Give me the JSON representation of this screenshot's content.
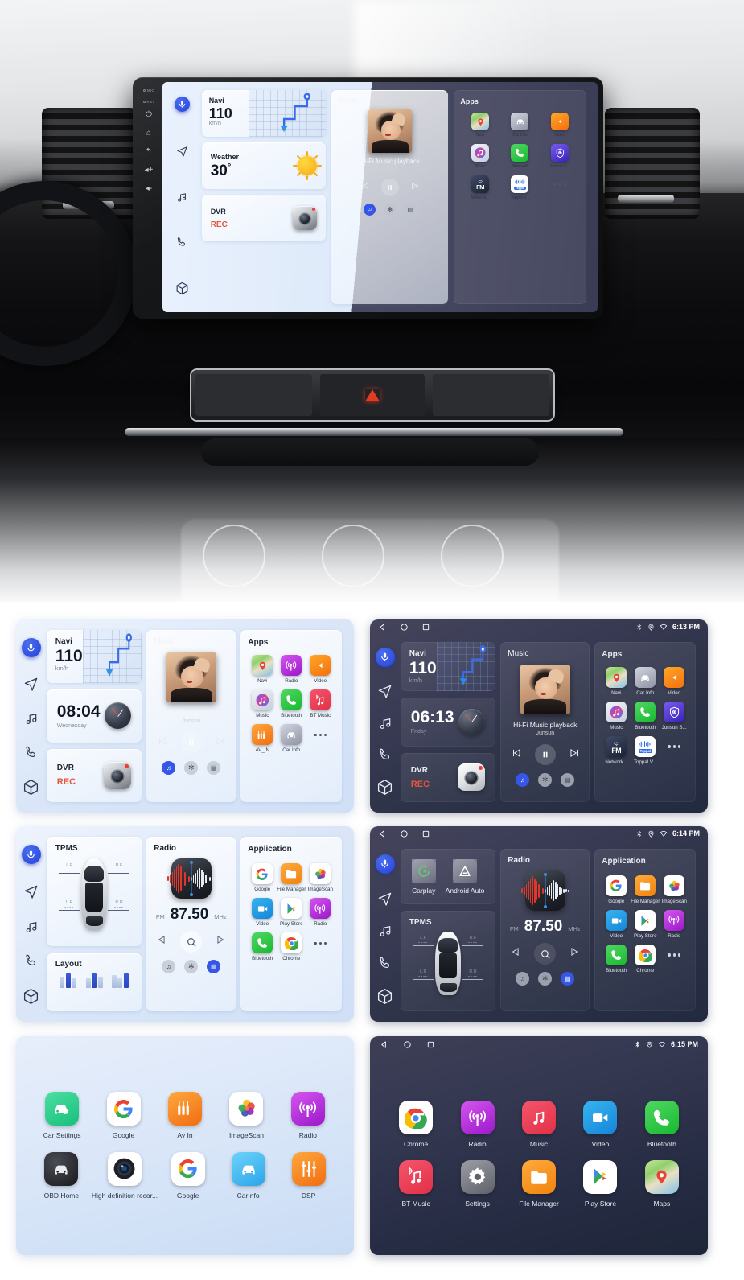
{
  "product": {
    "brand": "Junsun",
    "headunit_side_buttons": [
      "MIC",
      "RST",
      "power-icon",
      "home-icon",
      "back-icon",
      "volume-up-icon",
      "volume-down-icon"
    ]
  },
  "rail": {
    "items": [
      {
        "name": "voice-assistant",
        "icon": "microphone-icon"
      },
      {
        "name": "navigation",
        "icon": "paper-plane-icon"
      },
      {
        "name": "music",
        "icon": "music-note-icon"
      },
      {
        "name": "phone",
        "icon": "phone-handset-icon"
      },
      {
        "name": "apps",
        "icon": "cube-icon"
      }
    ]
  },
  "statusbar": {
    "nav_icons": [
      "back-triangle-icon",
      "home-circle-icon",
      "recents-square-icon"
    ],
    "tray_icons": [
      "bluetooth-icon",
      "location-pin-icon",
      "wifi-icon"
    ],
    "time_1": "6:13 PM",
    "time_2": "6:14 PM",
    "time_3": "6:15 PM"
  },
  "hero": {
    "navi": {
      "title": "Navi",
      "speed": "110",
      "unit": "km/h"
    },
    "weather": {
      "title": "Weather",
      "temp": "30",
      "degree": "°"
    },
    "dvr": {
      "title": "DVR",
      "status": "REC"
    },
    "music": {
      "title": "Music",
      "song": "Hi-Fi Music playback",
      "artist": "Junsun"
    },
    "apps": {
      "title": "Apps",
      "items": [
        {
          "label": "Navi",
          "icon": "maps-pin-icon"
        },
        {
          "label": "Car Info",
          "icon": "car-icon"
        },
        {
          "label": "Video",
          "icon": "play-triangle-icon"
        },
        {
          "label": "Music",
          "icon": "music-note-icon"
        },
        {
          "label": "Bluetooth",
          "icon": "phone-handset-icon"
        },
        {
          "label": "Junsun S...",
          "icon": "shield-icon"
        },
        {
          "label": "Network...",
          "icon": "fm-icon"
        },
        {
          "label": "Toppal V...",
          "icon": "toppal-icon"
        },
        {
          "label": "",
          "icon": "more-dots-icon"
        }
      ]
    }
  },
  "screen_light_home": {
    "navi": {
      "title": "Navi",
      "speed": "110",
      "unit": "km/h"
    },
    "clock": {
      "time": "08:04",
      "day": "Wednesday"
    },
    "dvr": {
      "title": "DVR",
      "status": "REC"
    },
    "music": {
      "title": "Music",
      "song": "Hi-Fi Music playback",
      "artist": "Junsun"
    },
    "apps": {
      "title": "Apps",
      "items": [
        {
          "label": "Navi",
          "icon": "maps-pin-icon"
        },
        {
          "label": "Radio",
          "icon": "radio-antenna-icon"
        },
        {
          "label": "Video",
          "icon": "play-triangle-icon"
        },
        {
          "label": "Music",
          "icon": "music-note-icon"
        },
        {
          "label": "Bluetooth",
          "icon": "phone-handset-icon"
        },
        {
          "label": "BT Music",
          "icon": "bt-music-icon"
        },
        {
          "label": "AV_IN",
          "icon": "av-in-icon"
        },
        {
          "label": "Car Info",
          "icon": "car-icon"
        },
        {
          "label": "",
          "icon": "more-dots-icon"
        }
      ]
    }
  },
  "screen_dark_home": {
    "navi": {
      "title": "Navi",
      "speed": "110",
      "unit": "km/h"
    },
    "clock": {
      "time": "06:13",
      "day": "Friday"
    },
    "dvr": {
      "title": "DVR",
      "status": "REC"
    },
    "music": {
      "title": "Music",
      "song": "Hi-Fi Music playback",
      "artist": "Junsun"
    },
    "apps": {
      "title": "Apps",
      "items": [
        {
          "label": "Navi",
          "icon": "maps-pin-icon"
        },
        {
          "label": "Car Info",
          "icon": "car-icon"
        },
        {
          "label": "Video",
          "icon": "play-triangle-icon"
        },
        {
          "label": "Music",
          "icon": "music-note-icon"
        },
        {
          "label": "Bluetooth",
          "icon": "phone-handset-icon"
        },
        {
          "label": "Junsun S...",
          "icon": "shield-icon"
        },
        {
          "label": "Network...",
          "icon": "fm-icon"
        },
        {
          "label": "Toppal V...",
          "icon": "toppal-icon"
        },
        {
          "label": "",
          "icon": "more-dots-icon"
        }
      ]
    }
  },
  "screen_light_radio": {
    "tpms": {
      "title": "TPMS",
      "wheels": [
        {
          "pos": "L.F",
          "value": "----"
        },
        {
          "pos": "R.F",
          "value": "----"
        },
        {
          "pos": "L.R",
          "value": "----"
        },
        {
          "pos": "R.R",
          "value": "----"
        }
      ]
    },
    "layout": {
      "title": "Layout"
    },
    "radio": {
      "title": "Radio",
      "band": "FM",
      "freq": "87.50",
      "unit": "MHz"
    },
    "application": {
      "title": "Application",
      "items": [
        {
          "label": "Google",
          "icon": "google-g-icon"
        },
        {
          "label": "File Manager",
          "icon": "folder-icon"
        },
        {
          "label": "ImageScan",
          "icon": "photos-flower-icon"
        },
        {
          "label": "Video",
          "icon": "video-camera-icon"
        },
        {
          "label": "Play Store",
          "icon": "play-store-icon"
        },
        {
          "label": "Radio",
          "icon": "radio-antenna-icon"
        },
        {
          "label": "Bluetooth",
          "icon": "phone-handset-icon"
        },
        {
          "label": "Chrome",
          "icon": "chrome-icon"
        },
        {
          "label": "",
          "icon": "more-dots-icon"
        }
      ]
    }
  },
  "screen_dark_radio": {
    "projection": {
      "items": [
        {
          "label": "Carplay",
          "icon": "carplay-icon"
        },
        {
          "label": "Android Auto",
          "icon": "android-auto-icon"
        }
      ]
    },
    "tpms": {
      "title": "TPMS",
      "wheels": [
        {
          "pos": "L.F",
          "value": "----"
        },
        {
          "pos": "R.F",
          "value": "----"
        },
        {
          "pos": "L.R",
          "value": "----"
        },
        {
          "pos": "R.R",
          "value": "----"
        }
      ]
    },
    "radio": {
      "title": "Radio",
      "band": "FM",
      "freq": "87.50",
      "unit": "MHz"
    },
    "application": {
      "title": "Application",
      "items": [
        {
          "label": "Google",
          "icon": "google-g-icon"
        },
        {
          "label": "File Manager",
          "icon": "folder-icon"
        },
        {
          "label": "ImageScan",
          "icon": "photos-flower-icon"
        },
        {
          "label": "Video",
          "icon": "video-camera-icon"
        },
        {
          "label": "Play Store",
          "icon": "play-store-icon"
        },
        {
          "label": "Radio",
          "icon": "radio-antenna-icon"
        },
        {
          "label": "Bluetooth",
          "icon": "phone-handset-icon"
        },
        {
          "label": "Chrome",
          "icon": "chrome-icon"
        },
        {
          "label": "",
          "icon": "more-dots-icon"
        }
      ]
    }
  },
  "drawer_light": {
    "row1": [
      {
        "label": "Car Settings",
        "icon": "car-settings-icon"
      },
      {
        "label": "Google",
        "icon": "google-g-icon"
      },
      {
        "label": "Av In",
        "icon": "av-in-icon"
      },
      {
        "label": "ImageScan",
        "icon": "photos-flower-icon"
      },
      {
        "label": "Radio",
        "icon": "radio-antenna-icon"
      }
    ],
    "row2": [
      {
        "label": "OBD Home",
        "icon": "obd-car-icon"
      },
      {
        "label": "High definition recor...",
        "icon": "camera-lens-icon"
      },
      {
        "label": "Google",
        "icon": "google-g-icon"
      },
      {
        "label": "CarInfo",
        "icon": "carinfo-icon"
      },
      {
        "label": "DSP",
        "icon": "dsp-sliders-icon"
      }
    ]
  },
  "drawer_dark": {
    "row1": [
      {
        "label": "Chrome",
        "icon": "chrome-icon"
      },
      {
        "label": "Radio",
        "icon": "radio-antenna-icon"
      },
      {
        "label": "Music",
        "icon": "music-note-icon"
      },
      {
        "label": "Video",
        "icon": "video-camera-icon"
      },
      {
        "label": "Bluetooth",
        "icon": "phone-handset-icon"
      }
    ],
    "row2": [
      {
        "label": "BT Music",
        "icon": "bt-music-icon"
      },
      {
        "label": "Settings",
        "icon": "gear-icon"
      },
      {
        "label": "File Manager",
        "icon": "folder-icon"
      },
      {
        "label": "Play Store",
        "icon": "play-store-icon"
      },
      {
        "label": "Maps",
        "icon": "maps-pin-icon"
      }
    ]
  },
  "colors": {
    "accent_blue": "#2f4fe0",
    "rec_red": "#e4573d",
    "light_panel": "#dce8f7",
    "dark_panel": "#30344b"
  }
}
